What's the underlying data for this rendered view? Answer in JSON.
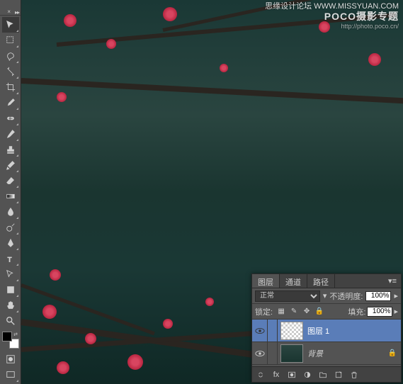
{
  "watermark": {
    "cn_text": "思缘设计论坛",
    "domain": "WWW.MISSYUAN.COM",
    "brand": "POCO摄影专题",
    "url": "http://photo.poco.cn/"
  },
  "tools": [
    "move",
    "marquee",
    "lasso",
    "wand",
    "crop",
    "eyedropper",
    "healing",
    "brush",
    "stamp",
    "history",
    "eraser",
    "gradient",
    "blur",
    "dodge",
    "pen",
    "type",
    "path",
    "rectangle",
    "hand",
    "zoom"
  ],
  "colors": {
    "foreground": "#000000",
    "background": "#ffffff"
  },
  "layers_panel": {
    "tabs": {
      "layers": "图层",
      "channels": "通道",
      "paths": "路径"
    },
    "blend_mode": "正常",
    "opacity_label": "不透明度:",
    "opacity_value": "100%",
    "lock_label": "锁定:",
    "fill_label": "填充:",
    "fill_value": "100%",
    "layers": [
      {
        "name": "图层 1",
        "selected": true,
        "locked": false,
        "thumb": "checker"
      },
      {
        "name": "背景",
        "selected": false,
        "locked": true,
        "thumb": "bg"
      }
    ]
  }
}
